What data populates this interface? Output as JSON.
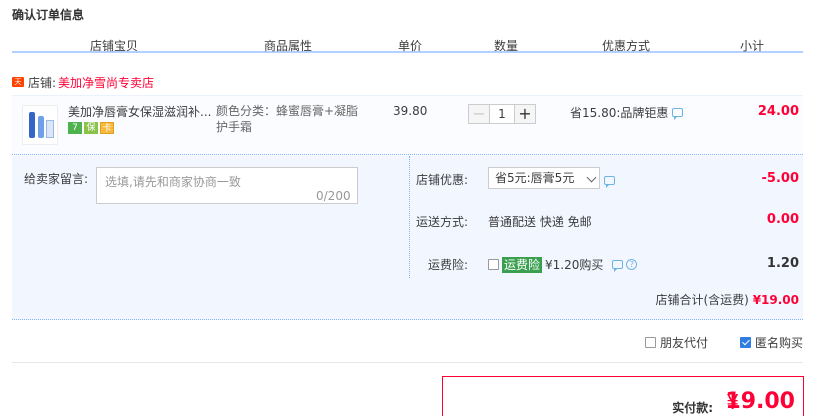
{
  "title": "确认订单信息",
  "columns": [
    "店铺宝贝",
    "商品属性",
    "单价",
    "数量",
    "优惠方式",
    "小计"
  ],
  "shop": {
    "badge": "天猫",
    "label": "店铺:",
    "name": "美加净雪尚专卖店"
  },
  "item": {
    "name": "美加净唇膏女保湿滋润补...",
    "icons": [
      "7",
      "保",
      "卡"
    ],
    "attr": "颜色分类：蜂蜜唇膏+凝脂护手霜",
    "price": "39.80",
    "qty": "1",
    "minus": "−",
    "plus": "+",
    "promo": "省15.80:品牌钜惠",
    "subtotal": "24.00"
  },
  "message": {
    "label": "给卖家留言:",
    "placeholder": "选填,请先和商家协商一致",
    "count": "0/200"
  },
  "coupon": {
    "label": "店铺优惠:",
    "selected": "省5元:唇膏5元",
    "value": "-5.00"
  },
  "shipping": {
    "label": "运送方式:",
    "text": "普通配送 快递 免邮",
    "value": "0.00"
  },
  "insurance": {
    "label": "运费险:",
    "badge": "运费险",
    "text": "¥1.20购买",
    "value": "1.20"
  },
  "shop_total": {
    "label": "店铺合计(含运费)",
    "amount": "¥19.00"
  },
  "options": {
    "friend_pay": "朋友代付",
    "anonymous": "匿名购买"
  },
  "payment": {
    "label": "实付款:",
    "symbol": "¥",
    "amount": "19.00"
  },
  "colors": {
    "accent_red": "#ff0036",
    "header_border": "#b2d1ff",
    "panel_bg": "#f2f7ff"
  }
}
